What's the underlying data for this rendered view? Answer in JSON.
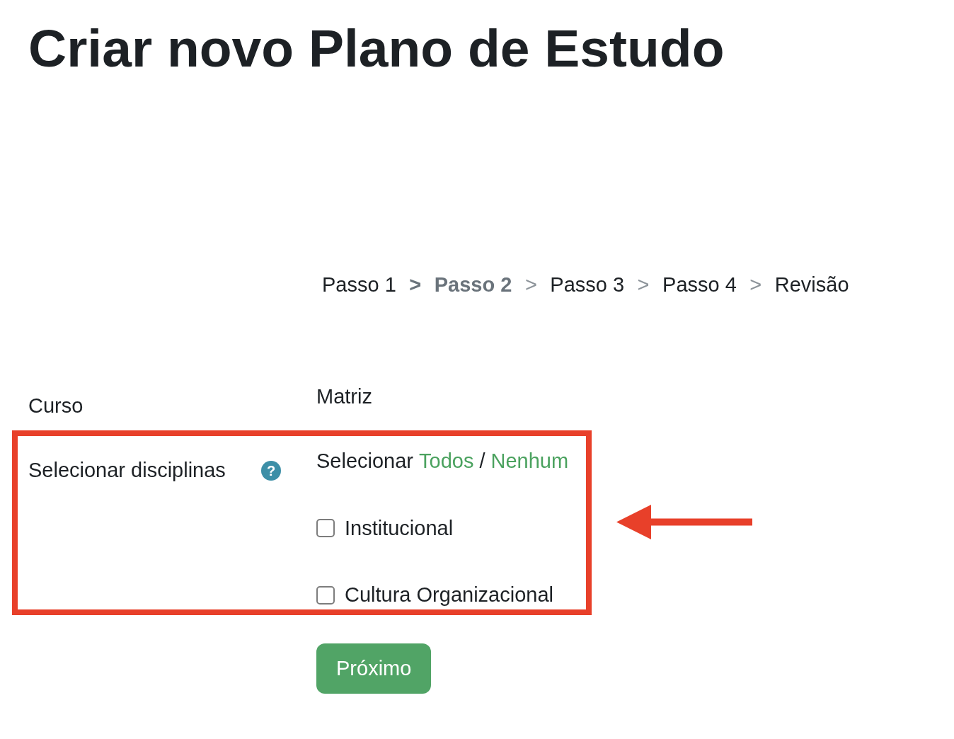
{
  "page": {
    "title": "Criar novo Plano de Estudo"
  },
  "steps": [
    {
      "label": "Passo 1",
      "selected": false
    },
    {
      "label": "Passo 2",
      "selected": true
    },
    {
      "label": "Passo 3",
      "selected": false
    },
    {
      "label": "Passo 4",
      "selected": false
    },
    {
      "label": "Revisão",
      "selected": false
    }
  ],
  "separators": [
    {
      "text": ">",
      "emphasized": true
    },
    {
      "text": ">",
      "emphasized": false
    },
    {
      "text": ">",
      "emphasized": false
    },
    {
      "text": ">",
      "emphasized": false
    }
  ],
  "form": {
    "fields": [
      {
        "kind": "static",
        "label": "Curso",
        "value": "Matriz",
        "highlighted": false
      },
      {
        "kind": "checklist",
        "label": "Selecionar disciplinas",
        "help": "?",
        "highlighted": true,
        "select_prefix": "Selecionar",
        "select_all": "Todos",
        "divider": "/",
        "select_none": "Nenhum",
        "options": [
          {
            "label": "Institucional",
            "checked": false
          },
          {
            "label": "Cultura Organizacional",
            "checked": false
          }
        ]
      }
    ],
    "submit": "Próximo"
  }
}
